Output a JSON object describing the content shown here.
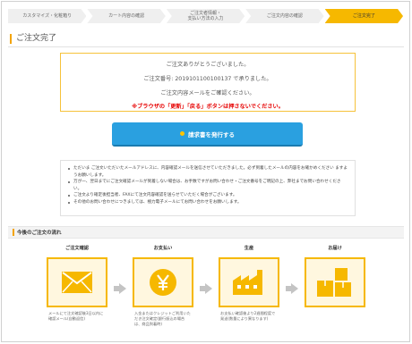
{
  "steps": [
    {
      "label": "カスタマイズ・化粧箱り"
    },
    {
      "label": "カート内容の確認"
    },
    {
      "label": "ご注文者情報・\n支払い方法の入力"
    },
    {
      "label": "ご注文内容の確認"
    },
    {
      "label": "ご注文完了",
      "active": true
    }
  ],
  "page_title": "ご注文完了",
  "thanks": {
    "line1": "ご注文ありがとうございました。",
    "line2": "ご注文番号: 2019101100100137 で承りました。",
    "line3": "ご注文内容メールをご確認ください。",
    "warning": "※ブラウザの「更新」「戻る」ボタンは押さないでください。"
  },
  "invoice_button": "請求書を発行する",
  "notes": [
    "ただいま ご注文いただいたメールアドレスに、内容確認メールを送信させていただきました。必ず到着したメールの内容をお確かめください ますようお願いします。",
    "万が一、翌日までにご注文確認メールが到着しない場合は、お手数ですがお問い合わせ・ご注文番号をご明記の上、弊社までお問い合わせください。",
    "ご注文より確定後担当者、FAXにて注文内容確認を送らせていただく場合がございます。",
    "その他のお問い合わせにつきましては、極力電子メールにてお問い合わせをお願いします。"
  ],
  "flow": {
    "title": "今後のご注文の流れ",
    "stages": [
      {
        "label": "ご注文確認",
        "icon": "envelope-icon",
        "desc": "メールにて注文確認後3日以内に確認メール(自動返信)"
      },
      {
        "label": "お支払い",
        "icon": "yen-icon",
        "desc": "入金またはクレジットご利用いただき注文確定(銀行振込の場合は、商品到着時)"
      },
      {
        "label": "生産",
        "icon": "factory-icon",
        "desc": "お支払い確認後より2週間程度で発送(数量により異なります)"
      },
      {
        "label": "お届け",
        "icon": "boxes-icon",
        "desc": ""
      }
    ]
  },
  "colors": {
    "accent": "#f6b800",
    "button": "#2aa0e0",
    "warning": "#e60000"
  }
}
